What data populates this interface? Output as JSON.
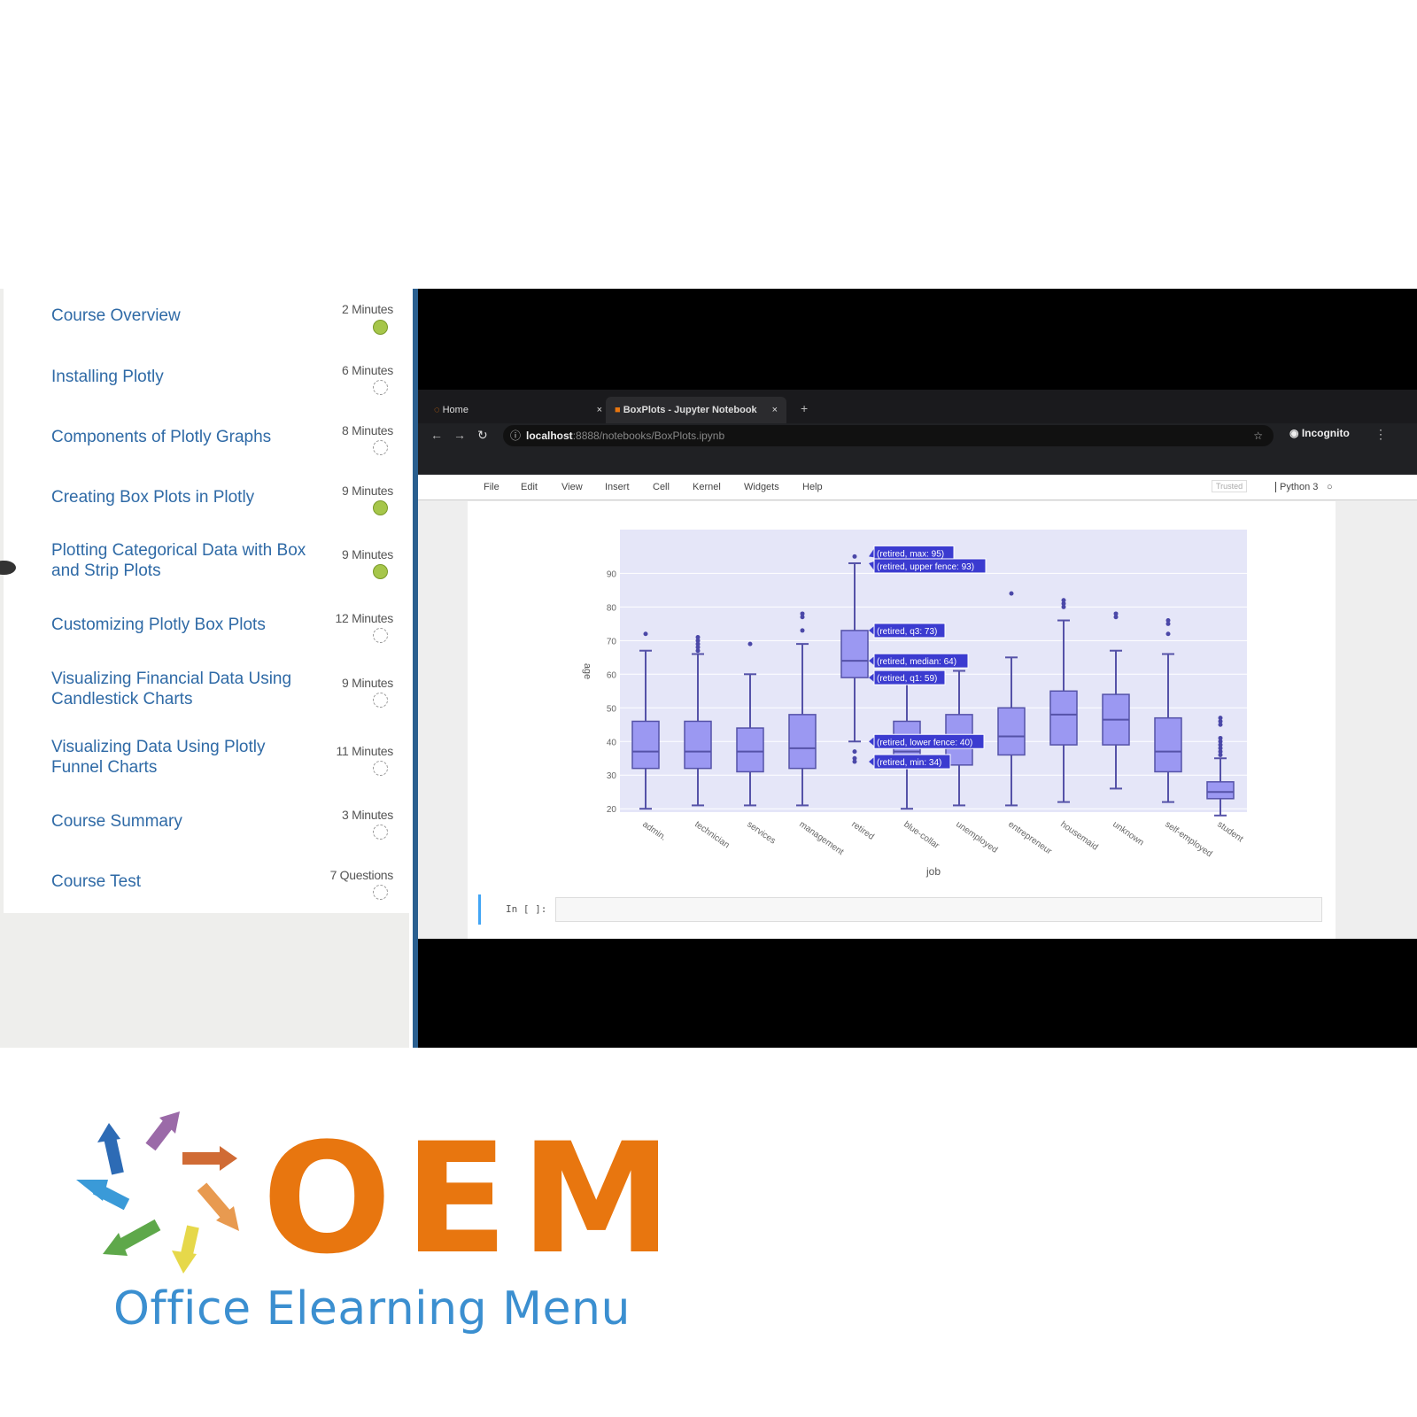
{
  "sidebar": {
    "items": [
      {
        "title": "Course Overview",
        "duration": "2 Minutes",
        "status": "completed"
      },
      {
        "title": "Installing Plotly",
        "duration": "6 Minutes",
        "status": "not-started"
      },
      {
        "title": "Components of Plotly Graphs",
        "duration": "8 Minutes",
        "status": "not-started"
      },
      {
        "title": "Creating Box Plots in Plotly",
        "duration": "9 Minutes",
        "status": "completed"
      },
      {
        "title": "Plotting Categorical Data with Box and Strip Plots",
        "duration": "9 Minutes",
        "status": "completed",
        "active": true
      },
      {
        "title": "Customizing Plotly Box Plots",
        "duration": "12 Minutes",
        "status": "not-started"
      },
      {
        "title": "Visualizing Financial Data Using Candlestick Charts",
        "duration": "9 Minutes",
        "status": "not-started"
      },
      {
        "title": "Visualizing Data Using Plotly Funnel Charts",
        "duration": "11 Minutes",
        "status": "not-started"
      },
      {
        "title": "Course Summary",
        "duration": "3 Minutes",
        "status": "not-started"
      },
      {
        "title": "Course Test",
        "duration": "7 Questions",
        "status": "not-started"
      }
    ],
    "colors": {
      "completed": "#a6c64a",
      "title": "#2f6aa6"
    }
  },
  "browser": {
    "tabs": [
      {
        "label": "Home"
      },
      {
        "label": "BoxPlots - Jupyter Notebook"
      }
    ],
    "url_host": "localhost",
    "url_path": ":8888/notebooks/BoxPlots.ipynb",
    "profile": "Incognito"
  },
  "jupyter": {
    "menu": [
      "File",
      "Edit",
      "View",
      "Insert",
      "Cell",
      "Kernel",
      "Widgets",
      "Help"
    ],
    "trusted": "Trusted",
    "kernel": "Python 3",
    "cell_prompt": "In [ ]:"
  },
  "chart_data": {
    "type": "box",
    "xlabel": "job",
    "ylabel": "age",
    "ylim": [
      19,
      103
    ],
    "yticks": [
      20,
      30,
      40,
      50,
      60,
      70,
      80,
      90
    ],
    "grid": true,
    "color": "#8f8ff0",
    "categories": [
      "admin.",
      "technician",
      "services",
      "management",
      "retired",
      "blue-collar",
      "unemployed",
      "entrepreneur",
      "housemaid",
      "unknown",
      "self-employed",
      "student"
    ],
    "boxes": [
      {
        "lower": 20,
        "q1": 32,
        "median": 37,
        "q3": 46,
        "upper": 67,
        "outliers": [
          72
        ]
      },
      {
        "lower": 21,
        "q1": 32,
        "median": 37,
        "q3": 46,
        "upper": 66,
        "outliers": [
          67,
          68,
          69,
          70,
          71
        ]
      },
      {
        "lower": 21,
        "q1": 31,
        "median": 37,
        "q3": 44,
        "upper": 60,
        "outliers": [
          69
        ]
      },
      {
        "lower": 21,
        "q1": 32,
        "median": 38,
        "q3": 48,
        "upper": 69,
        "outliers": [
          73,
          77,
          78
        ]
      },
      {
        "lower": 40,
        "q1": 59,
        "median": 64,
        "q3": 73,
        "upper": 93,
        "outliers": [
          95,
          34,
          35,
          37
        ]
      },
      {
        "lower": 20,
        "q1": 32,
        "median": 37,
        "q3": 46,
        "upper": 60,
        "outliers": []
      },
      {
        "lower": 21,
        "q1": 33,
        "median": 38,
        "q3": 48,
        "upper": 61,
        "outliers": []
      },
      {
        "lower": 21,
        "q1": 36,
        "median": 41.5,
        "q3": 50,
        "upper": 65,
        "outliers": [
          84
        ]
      },
      {
        "lower": 22,
        "q1": 39,
        "median": 48,
        "q3": 55,
        "upper": 76,
        "outliers": [
          80,
          81,
          82
        ]
      },
      {
        "lower": 26,
        "q1": 39,
        "median": 46.5,
        "q3": 54,
        "upper": 67,
        "outliers": [
          77,
          78
        ]
      },
      {
        "lower": 22,
        "q1": 31,
        "median": 37,
        "q3": 47,
        "upper": 66,
        "outliers": [
          72,
          75,
          76
        ]
      },
      {
        "lower": 18,
        "q1": 23,
        "median": 25,
        "q3": 28,
        "upper": 35,
        "outliers": [
          36,
          37,
          38,
          39,
          40,
          41,
          45,
          46,
          47
        ]
      }
    ],
    "hover_labels": [
      {
        "text": "(retired, max: 95)",
        "value": 95
      },
      {
        "text": "(retired, upper fence: 93)",
        "value": 93
      },
      {
        "text": "(retired, q3: 73)",
        "value": 73
      },
      {
        "text": "(retired, median: 64)",
        "value": 64
      },
      {
        "text": "(retired, q1: 59)",
        "value": 59
      },
      {
        "text": "(retired, lower fence: 40)",
        "value": 40
      },
      {
        "text": "(retired, min: 34)",
        "value": 34
      }
    ]
  },
  "logo": {
    "mark": "OEM",
    "tagline": "Office Elearning Menu",
    "colors": {
      "mark": "#e8760f",
      "tagline": "#3b8fd0"
    }
  }
}
